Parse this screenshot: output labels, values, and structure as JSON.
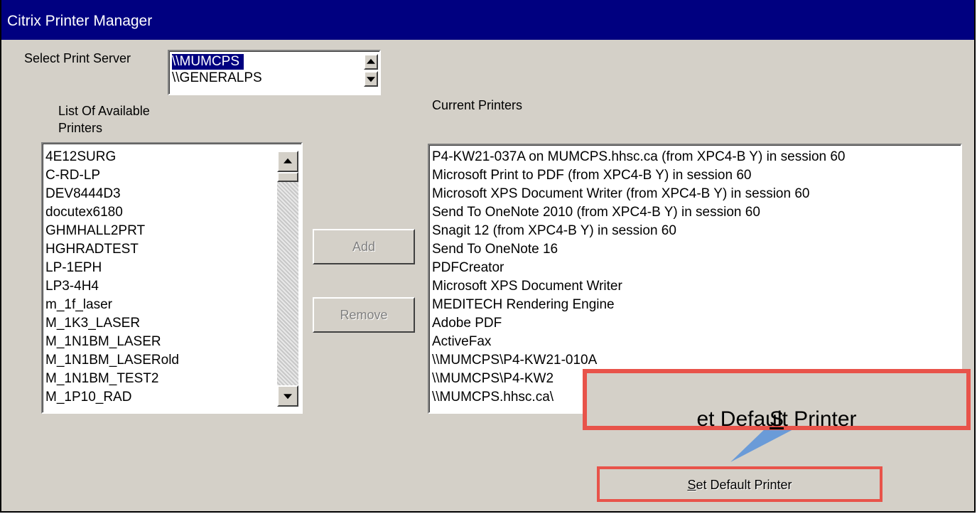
{
  "window": {
    "title": "Citrix Printer Manager"
  },
  "server": {
    "label": "Select Print Server",
    "options": [
      "\\\\MUMCPS",
      "\\\\GENERALPS"
    ]
  },
  "available": {
    "label_line1": "List Of Available",
    "label_line2": "Printers",
    "items": [
      "4E12SURG",
      "C-RD-LP",
      "DEV8444D3",
      "docutex6180",
      "GHMHALL2PRT",
      "HGHRADTEST",
      "LP-1EPH",
      "LP3-4H4",
      "m_1f_laser",
      "M_1K3_LASER",
      "M_1N1BM_LASER",
      "M_1N1BM_LASERold",
      "M_1N1BM_TEST2",
      "M_1P10_RAD"
    ]
  },
  "current": {
    "label": "Current Printers",
    "items": [
      "P4-KW21-037A on MUMCPS.hhsc.ca (from XPC4-B        Y) in session 60",
      "Microsoft Print to PDF (from XPC4-B        Y) in session 60",
      "Microsoft XPS Document Writer (from XPC4-B        Y) in session 60",
      "Send To OneNote 2010 (from XPC4-B        Y) in session 60",
      "Snagit 12 (from XPC4-B        Y) in session 60",
      "Send To OneNote 16",
      "PDFCreator",
      "Microsoft XPS Document Writer",
      "MEDITECH Rendering Engine",
      "Adobe PDF",
      "ActiveFax",
      "\\\\MUMCPS\\P4-KW21-010A",
      "\\\\MUMCPS\\P4-KW2",
      "\\\\MUMCPS.hhsc.ca\\"
    ]
  },
  "buttons": {
    "add": "Add",
    "remove": "Remove",
    "set_default_accel": "S",
    "set_default_rest": "et Default Printer"
  },
  "callout": {
    "accel": "S",
    "rest": "et Default Printer",
    "border_color": "#e8534a",
    "pointer_color": "#6a9bd8"
  }
}
